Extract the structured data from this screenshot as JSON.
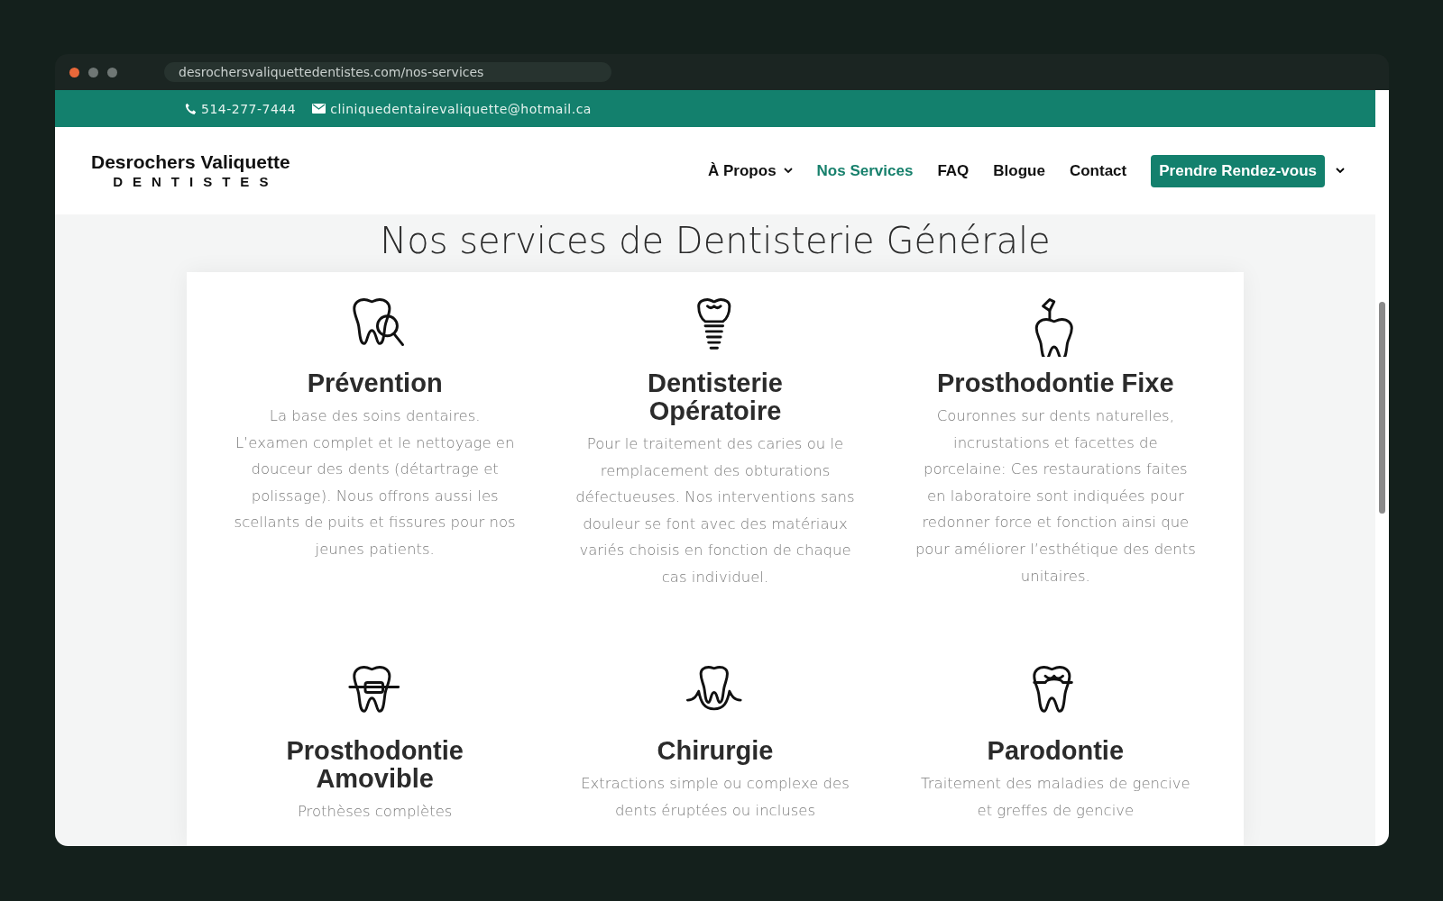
{
  "browser": {
    "url": "desrochersvaliquettedentistes.com/nos-services"
  },
  "contact_bar": {
    "phone": "514-277-7444",
    "email": "cliniquedentairevaliquette@hotmail.ca"
  },
  "header": {
    "logo_name": "Desrochers Valiquette",
    "logo_subtitle": "DENTISTES",
    "nav": [
      {
        "label": "À Propos",
        "has_dropdown": true,
        "selected": false
      },
      {
        "label": "Nos Services",
        "has_dropdown": false,
        "selected": true
      },
      {
        "label": "FAQ",
        "has_dropdown": false,
        "selected": false
      },
      {
        "label": "Blogue",
        "has_dropdown": false,
        "selected": false
      },
      {
        "label": "Contact",
        "has_dropdown": false,
        "selected": false
      }
    ],
    "cta": {
      "label": "Prendre Rendez-vous",
      "has_dropdown": true
    }
  },
  "page_title": "Nos services de Dentisterie Générale",
  "services": [
    {
      "kind": "magnifier",
      "title": "Prévention",
      "description": "La base des soins dentaires. L’examen complet et le nettoyage en douceur des dents (détartrage et polissage). Nous offrons aussi les scellants de puits et fissures pour nos jeunes patients."
    },
    {
      "kind": "implant",
      "title": "Dentisterie Opératoire",
      "description": "Pour le traitement des caries ou le remplacement des obturations défectueuses. Nos interventions sans douleur se font avec des matériaux variés choisis en fonction de chaque cas individuel."
    },
    {
      "kind": "filling",
      "title": "Prosthodontie Fixe",
      "description": "Couronnes sur dents naturelles, incrustations et facettes de porcelaine: Ces restaurations faites en laboratoire sont indiquées pour redonner force et fonction ainsi que pour améliorer l’esthétique des dents unitaires."
    },
    {
      "kind": "braces",
      "title": "Prosthodontie Amovible",
      "description": "Prothèses complètes"
    },
    {
      "kind": "extraction",
      "title": "Chirurgie",
      "description": "Extractions simple ou complexe des dents éruptées ou incluses"
    },
    {
      "kind": "crown",
      "title": "Parodontie",
      "description": "Traitement des maladies de gencive et greffes de gencive"
    }
  ]
}
